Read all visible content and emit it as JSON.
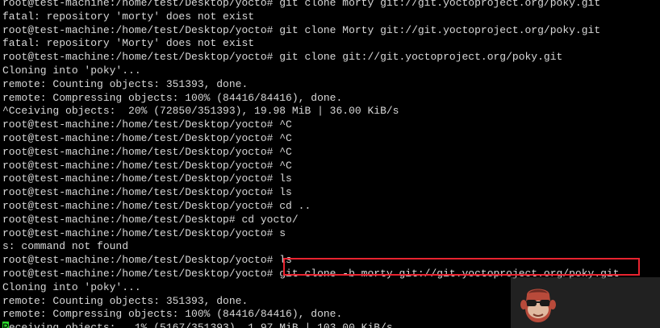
{
  "terminal": {
    "colors": {
      "background": "#000000",
      "foreground": "#d8d8d8",
      "cursor": "#2bd62b",
      "highlight_border": "#e8232f"
    },
    "lines": [
      "root@test-machine:/home/test/Desktop/yocto# git clone morty git://git.yoctoproject.org/poky.git",
      "fatal: repository 'morty' does not exist",
      "root@test-machine:/home/test/Desktop/yocto# git clone Morty git://git.yoctoproject.org/poky.git",
      "fatal: repository 'Morty' does not exist",
      "root@test-machine:/home/test/Desktop/yocto# git clone git://git.yoctoproject.org/poky.git",
      "Cloning into 'poky'...",
      "remote: Counting objects: 351393, done.",
      "remote: Compressing objects: 100% (84416/84416), done.",
      "^Cceiving objects:  20% (72850/351393), 19.98 MiB | 36.00 KiB/s",
      "root@test-machine:/home/test/Desktop/yocto# ^C",
      "root@test-machine:/home/test/Desktop/yocto# ^C",
      "root@test-machine:/home/test/Desktop/yocto# ^C",
      "root@test-machine:/home/test/Desktop/yocto# ^C",
      "root@test-machine:/home/test/Desktop/yocto# ls",
      "root@test-machine:/home/test/Desktop/yocto# ls",
      "root@test-machine:/home/test/Desktop/yocto# cd ..",
      "root@test-machine:/home/test/Desktop# cd yocto/",
      "root@test-machine:/home/test/Desktop/yocto# s",
      "s: command not found",
      "root@test-machine:/home/test/Desktop/yocto# ls",
      "root@test-machine:/home/test/Desktop/yocto# git clone -b morty git://git.yoctoproject.org/poky.git",
      "Cloning into 'poky'...",
      "remote: Counting objects: 351393, done.",
      "remote: Compressing objects: 100% (84416/84416), done."
    ],
    "last_line": {
      "cursor_char": "R",
      "rest": "eceiving objects:   1% (5167/351393), 1.97 MiB | 103.00 KiB/s"
    },
    "highlighted_command": "git clone -b morty git://git.yoctoproject.org/poky.git"
  },
  "watermark": {
    "icon": "monkey-face-icon"
  }
}
